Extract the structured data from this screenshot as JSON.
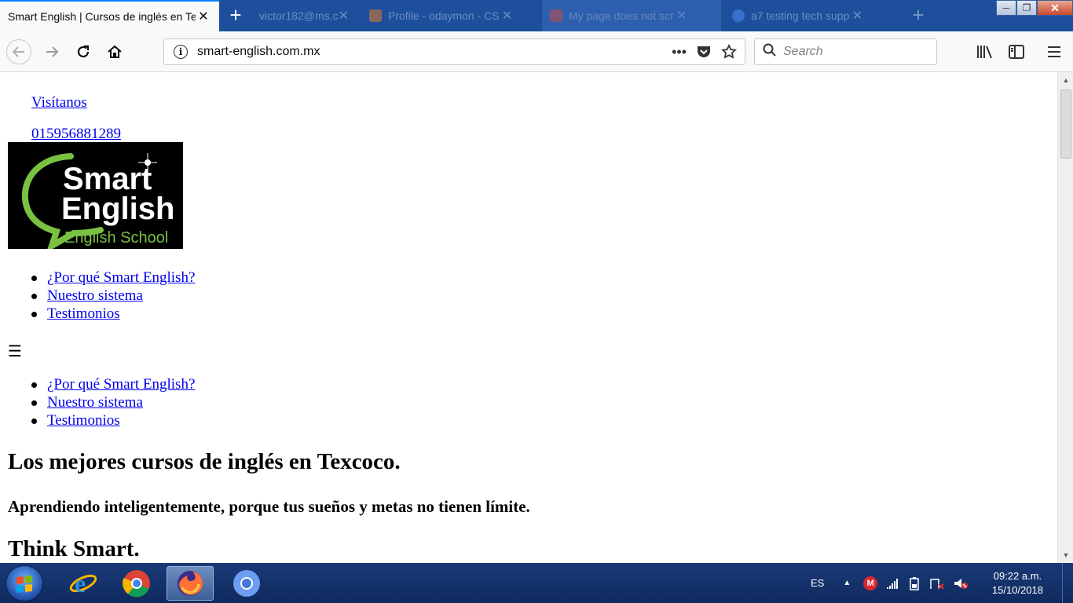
{
  "browser": {
    "tabs": [
      {
        "title": "Smart English | Cursos de inglés en Texcoco",
        "active": true
      },
      {
        "title": "victor182@ms.c",
        "active": false
      },
      {
        "title": "Profile - odaymon - CS",
        "active": false
      },
      {
        "title": "My page does not scr",
        "active": false
      },
      {
        "title": "a7 testing tech supp",
        "active": false
      }
    ],
    "url": "smart-english.com.mx",
    "search_placeholder": "Search",
    "window": {
      "minimize": "─",
      "restore": "❐",
      "close": "✕"
    },
    "new_tab": "+"
  },
  "page": {
    "visit_link": "Visítanos",
    "phone_link": "015956881289",
    "logo": {
      "line1": "Smart",
      "line2": "English",
      "line3": "English School"
    },
    "menu_top": [
      "¿Por qué Smart English?",
      "Nuestro sistema",
      "Testimonios"
    ],
    "hamburger": "☰",
    "menu_bottom": [
      "¿Por qué Smart English?",
      "Nuestro sistema",
      "Testimonios"
    ],
    "heading": "Los mejores cursos de inglés en Texcoco.",
    "subheading": "Aprendiendo inteligentemente, porque tus sueños y metas no tienen límite.",
    "tagline": "Think Smart."
  },
  "taskbar": {
    "language": "ES",
    "time": "09:22 a.m.",
    "date": "15/10/2018"
  },
  "colors": {
    "tabstrip": "#1d4f9c",
    "link": "#0000ee",
    "logo_green": "#7ac142",
    "taskbar": "#0f2a5e"
  }
}
